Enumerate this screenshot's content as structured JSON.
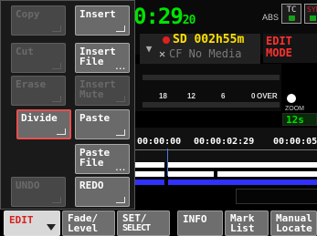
{
  "header": {
    "timecode": "0:29",
    "timecode_suffix": "20",
    "abs_label": "ABS",
    "tc_button": "TC",
    "sync_button": "SYN"
  },
  "media": {
    "sd_label": "SD",
    "sd_time": "002h55m",
    "cf_label": "CF No Media",
    "mode_line1": "EDIT",
    "mode_line2": "MODE"
  },
  "meter": {
    "scale": [
      "18",
      "12",
      "6",
      "0",
      "OVER"
    ]
  },
  "zoom": {
    "label": "ZOOM",
    "value": "12s"
  },
  "timeline": {
    "t1": "00:00:00",
    "t2": "00:00:02:29",
    "t3": "00:00:05"
  },
  "menu": {
    "buttons": [
      {
        "label": "Copy",
        "enabled": false
      },
      {
        "label": "Insert",
        "enabled": true
      },
      {
        "label": "Cut",
        "enabled": false
      },
      {
        "label": "Insert File",
        "enabled": true
      },
      {
        "label": "Erase",
        "enabled": false
      },
      {
        "label": "Insert Mute",
        "enabled": false
      },
      {
        "label": "Divide",
        "enabled": true,
        "selected": true
      },
      {
        "label": "Paste",
        "enabled": true
      },
      {
        "label": "Paste File",
        "enabled": true
      },
      {
        "label": "UNDO",
        "enabled": false
      },
      {
        "label": "REDO",
        "enabled": true
      }
    ]
  },
  "tabs": [
    {
      "line1": "EDIT",
      "line2": "",
      "active": true
    },
    {
      "line1": "Fade/",
      "line2": "Level"
    },
    {
      "line1": "SET/",
      "line2": "SELECT"
    },
    {
      "line1": "INFO",
      "line2": ""
    },
    {
      "line1": "Mark",
      "line2": "List"
    },
    {
      "line1": "Manual",
      "line2": "Locate"
    }
  ],
  "colors": {
    "timecode": "#00e400",
    "sd_text": "#ffe000",
    "edit_mode": "#ff3030",
    "selected_border": "#e85050",
    "active_tab_text": "#d82020"
  }
}
